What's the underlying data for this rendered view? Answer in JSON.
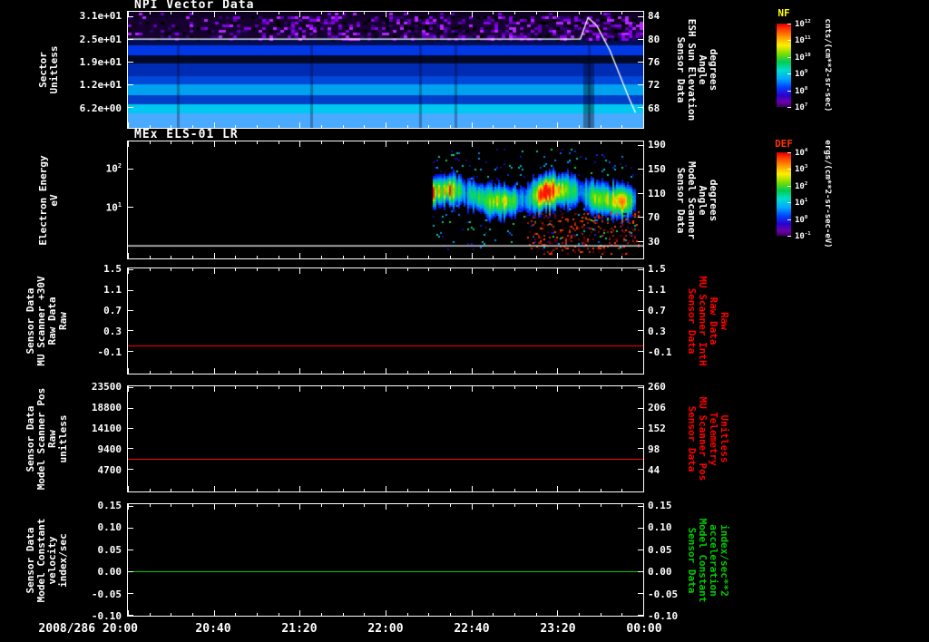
{
  "colors": {
    "background": "#000000",
    "foreground": "#ffffff",
    "red_series": "#ff0000",
    "green_series": "#00cc00",
    "nf_label": "#ffff00",
    "def_label": "#ff3300"
  },
  "x_axis": {
    "start_label": "2008/286 20:00",
    "tick_labels": [
      "20:40",
      "21:20",
      "22:00",
      "22:40",
      "23:20",
      "00:00"
    ]
  },
  "panels": [
    {
      "title": "NPI Vector Data",
      "left_label_lines": [
        "Sector",
        "Unitless"
      ],
      "left_ticks": [
        "3.1e+01",
        "2.5e+01",
        "1.9e+01",
        "1.2e+01",
        "6.2e+00"
      ],
      "right_ticks": [
        "84",
        "80",
        "76",
        "72",
        "68"
      ],
      "right_label_lines": [
        "Sensor Data",
        "ESH Sun Elevation",
        "Angle",
        "degrees"
      ],
      "right_label_color": "#ffffff"
    },
    {
      "title": "MEx ELS-01 LR",
      "left_label_lines": [
        "Electron Energy",
        "eV"
      ],
      "left_ticks": [
        "10^2",
        "10^1"
      ],
      "right_ticks": [
        "190",
        "150",
        "110",
        "70",
        "30"
      ],
      "right_label_lines": [
        "Sensor Data",
        "Model Scanner",
        "Angle",
        "degrees"
      ],
      "right_label_color": "#ffffff"
    },
    {
      "title": "",
      "left_label_lines": [
        "Sensor Data",
        "MU Scanner +30V",
        "Raw Data",
        "Raw"
      ],
      "left_ticks": [
        "1.5",
        "1.1",
        "0.7",
        "0.3",
        "-0.1"
      ],
      "right_ticks": [
        "1.5",
        "1.1",
        "0.7",
        "0.3",
        "-0.1"
      ],
      "right_label_lines": [
        "Sensor Data",
        "MU Scanner IntH",
        "Raw Data",
        "Raw"
      ],
      "right_label_color": "#ff0000"
    },
    {
      "title": "",
      "left_label_lines": [
        "Sensor Data",
        "Model Scanner Pos",
        "Raw",
        "unitless"
      ],
      "left_ticks": [
        "23500",
        "18800",
        "14100",
        "9400",
        "4700"
      ],
      "right_ticks": [
        "260",
        "206",
        "152",
        "98",
        "44"
      ],
      "right_label_lines": [
        "Sensor Data",
        "MU Scanner Pos",
        "Telemetry",
        "Unitless"
      ],
      "right_label_color": "#ff0000"
    },
    {
      "title": "",
      "left_label_lines": [
        "Sensor Data",
        "Model Constant",
        "velocity",
        "index/sec"
      ],
      "left_ticks": [
        "0.15",
        "0.10",
        "0.05",
        "0.00",
        "-0.05",
        "-0.10"
      ],
      "right_ticks": [
        "0.15",
        "0.10",
        "0.05",
        "0.00",
        "-0.05",
        "-0.10"
      ],
      "right_label_lines": [
        "Sensor Data",
        "Model Constant",
        "acceleration",
        "index/sec**2"
      ],
      "right_label_color": "#00cc00"
    }
  ],
  "colorbars": [
    {
      "name": "NF",
      "name_color": "#ffff00",
      "ticks": [
        "10^12",
        "10^11",
        "10^10",
        "10^9",
        "10^8",
        "10^7"
      ],
      "units": "cnts/(cm**2-sr-sec)"
    },
    {
      "name": "DEF",
      "name_color": "#ff3300",
      "ticks": [
        "10^4",
        "10^3",
        "10^2",
        "10^1",
        "10^0",
        "10^-1"
      ],
      "units": "ergs/(cm**2-sr-sec-eV)"
    }
  ],
  "chart_data": [
    {
      "type": "heatmap",
      "title": "NPI Vector Data",
      "xlabel": "Time (2008/286 20:00 - 00:00)",
      "ylabel": "Sector Unitless",
      "yticks": [
        31,
        25,
        19,
        12,
        6.2
      ],
      "y2label": "Sensor Data ESH Sun Elevation Angle degrees",
      "y2ticks": [
        84,
        80,
        76,
        72,
        68
      ],
      "colorbar": {
        "name": "NF",
        "units": "cnts/(cm**2-sr-sec)",
        "ticks_log10": [
          12,
          11,
          10,
          9,
          8,
          7
        ]
      },
      "bands": [
        {
          "y0": 0.0,
          "y1": 0.05,
          "color": "#0d0022"
        },
        {
          "y0": 0.05,
          "y1": 0.23,
          "color": "#16002e"
        },
        {
          "y0": 0.23,
          "y1": 0.29,
          "color": "#000d50"
        },
        {
          "y0": 0.29,
          "y1": 0.375,
          "color": "#0038e8"
        },
        {
          "y0": 0.375,
          "y1": 0.45,
          "color": "#000a28"
        },
        {
          "y0": 0.45,
          "y1": 0.56,
          "color": "#002cb4"
        },
        {
          "y0": 0.56,
          "y1": 0.63,
          "color": "#0048d8"
        },
        {
          "y0": 0.63,
          "y1": 0.72,
          "color": "#00a2f0"
        },
        {
          "y0": 0.72,
          "y1": 0.8,
          "color": "#0040c8"
        },
        {
          "y0": 0.8,
          "y1": 0.88,
          "color": "#00c8f0"
        },
        {
          "y0": 0.88,
          "y1": 1.0,
          "color": "#49aaff"
        }
      ],
      "speckle_colors": [
        "#8800ee",
        "#5e00b4",
        "#b428ff",
        "#31006e",
        "#000000"
      ],
      "overlay_line": {
        "name": "ESH Sun Elevation Angle",
        "color": "#ffffff",
        "points": [
          [
            "20:00",
            80
          ],
          [
            "23:30",
            80
          ],
          [
            "23:34",
            84
          ],
          [
            "23:39",
            82
          ],
          [
            "23:44",
            78
          ],
          [
            "23:49",
            73.5
          ],
          [
            "23:53",
            69.5
          ],
          [
            "23:56",
            67
          ]
        ],
        "points_frac": [
          [
            0,
            0.235
          ],
          [
            0.878,
            0.235
          ],
          [
            0.893,
            0.05
          ],
          [
            0.91,
            0.12
          ],
          [
            0.935,
            0.33
          ],
          [
            0.955,
            0.55
          ],
          [
            0.972,
            0.74
          ],
          [
            0.985,
            0.87
          ]
        ]
      }
    },
    {
      "type": "heatmap",
      "title": "MEx ELS-01 LR",
      "ylabel": "Electron Energy eV",
      "yticks_log10": [
        2,
        1
      ],
      "y2label": "Sensor Data Model Scanner Angle degrees",
      "y2ticks": [
        190,
        150,
        110,
        70,
        30
      ],
      "colorbar": {
        "name": "DEF",
        "units": "ergs/(cm**2-sr-sec-eV)",
        "ticks_log10": [
          4,
          3,
          2,
          1,
          0,
          -1
        ]
      },
      "blob": {
        "x0": 0.593,
        "x1": 0.985,
        "y_center": 0.46,
        "sigma": 0.11,
        "hotspot_x": 0.807,
        "note": "electron flux band ~10-100 eV starting ~22:22, peak flux near 23:12"
      },
      "overlay_line": {
        "name": "Model Scanner Angle",
        "color": "#ffffff",
        "constant_value_deg": 21,
        "points_frac": [
          [
            0,
            0.893
          ],
          [
            1,
            0.893
          ]
        ]
      }
    },
    {
      "type": "line",
      "ylabel": "Sensor Data MU Scanner +30V Raw Data Raw",
      "y2label": "Sensor Data MU Scanner IntH Raw Data Raw",
      "ylim": [
        -0.55,
        1.52
      ],
      "yticks": [
        1.5,
        1.1,
        0.7,
        0.3,
        -0.1
      ],
      "series": [
        {
          "name": "MU Scanner +30V Raw",
          "color": "#ff0000",
          "constant_value": 0.0
        }
      ]
    },
    {
      "type": "line",
      "ylabel": "Sensor Data Model Scanner Pos Raw unitless",
      "y2label": "Sensor Data MU Scanner Pos Telemetry Unitless",
      "ylim": [
        -360,
        23740
      ],
      "yticks": [
        23500,
        18800,
        14100,
        9400,
        4700
      ],
      "y2ticks": [
        260,
        206,
        152,
        98,
        44
      ],
      "series": [
        {
          "name": "Model Scanner Pos Raw",
          "color": "#ff0000",
          "constant_value": 7200
        }
      ]
    },
    {
      "type": "line",
      "ylabel": "Sensor Data Model Constant velocity index/sec",
      "y2label": "Sensor Data Model Constant acceleration index/sec**2",
      "ylim": [
        -0.102,
        0.154
      ],
      "yticks": [
        0.15,
        0.1,
        0.05,
        0.0,
        -0.05,
        -0.1
      ],
      "series": [
        {
          "name": "Model Constant velocity",
          "color": "#00cc00",
          "constant_value": 0.0
        }
      ]
    }
  ]
}
